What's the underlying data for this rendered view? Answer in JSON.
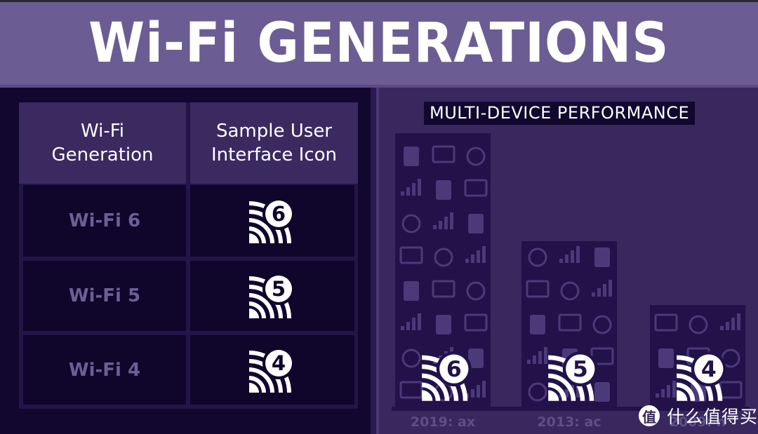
{
  "header": {
    "title": "Wi-Fi GENERATIONS"
  },
  "table": {
    "columns": [
      "Wi-Fi\nGeneration",
      "Sample User\nInterface Icon"
    ],
    "column_lines": [
      [
        "Wi-Fi",
        "Generation"
      ],
      [
        "Sample User",
        "Interface Icon"
      ]
    ],
    "rows": [
      {
        "generation": "Wi-Fi 6",
        "icon": "wifi-6-icon",
        "icon_number": "6"
      },
      {
        "generation": "Wi-Fi 5",
        "icon": "wifi-5-icon",
        "icon_number": "5"
      },
      {
        "generation": "Wi-Fi 4",
        "icon": "wifi-4-icon",
        "icon_number": "4"
      }
    ]
  },
  "colors": {
    "header_bg": "#6b5d93",
    "left_bg": "#12072e",
    "right_bg": "#38285e",
    "bar": "#221249",
    "table_header": "#3a2a60",
    "table_label": "#6c5f95",
    "icon": "#ffffff"
  },
  "chart_data": {
    "type": "bar",
    "title": "MULTI-DEVICE PERFORMANCE",
    "categories": [
      "2019: ax",
      "2013: ac",
      "2009: n"
    ],
    "icon_numbers": [
      "6",
      "5",
      "4"
    ],
    "values": [
      100,
      61,
      38
    ],
    "xlabel": "",
    "ylabel": "",
    "ylim": [
      0,
      100
    ],
    "grid": false,
    "axes_visible": false,
    "legend": "none",
    "note": "Relative multi-device performance; bars unlabeled numerically, values estimated relative to tallest bar"
  },
  "watermark": {
    "badge": "值",
    "text": "什么值得买"
  }
}
